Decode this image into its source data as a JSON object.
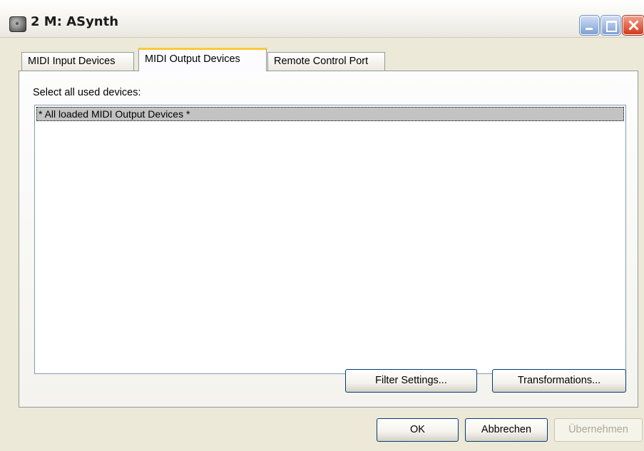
{
  "window": {
    "title": "2 M: ASynth",
    "app_icon": "midi-plugin-icon",
    "controls": {
      "minimize": "minimize-icon",
      "maximize": "maximize-icon",
      "close": "close-icon"
    }
  },
  "tabs": [
    {
      "label": "MIDI Input Devices",
      "active": false
    },
    {
      "label": "MIDI Output Devices",
      "active": true
    },
    {
      "label": "Remote Control Port",
      "active": false
    }
  ],
  "panel": {
    "select_label": "Select all used devices:",
    "list_items": [
      "* All loaded MIDI Output Devices *"
    ],
    "buttons": {
      "filter_settings": "Filter Settings...",
      "transformations": "Transformations..."
    }
  },
  "footer": {
    "ok": "OK",
    "cancel": "Abbrechen",
    "apply": "Übernehmen",
    "apply_enabled": false
  },
  "colors": {
    "active_tab_accent": "#ffc83c",
    "selection_bg": "#c3c3c3",
    "dialog_bg": "#ece9d8",
    "close_button": "#d5381a"
  }
}
